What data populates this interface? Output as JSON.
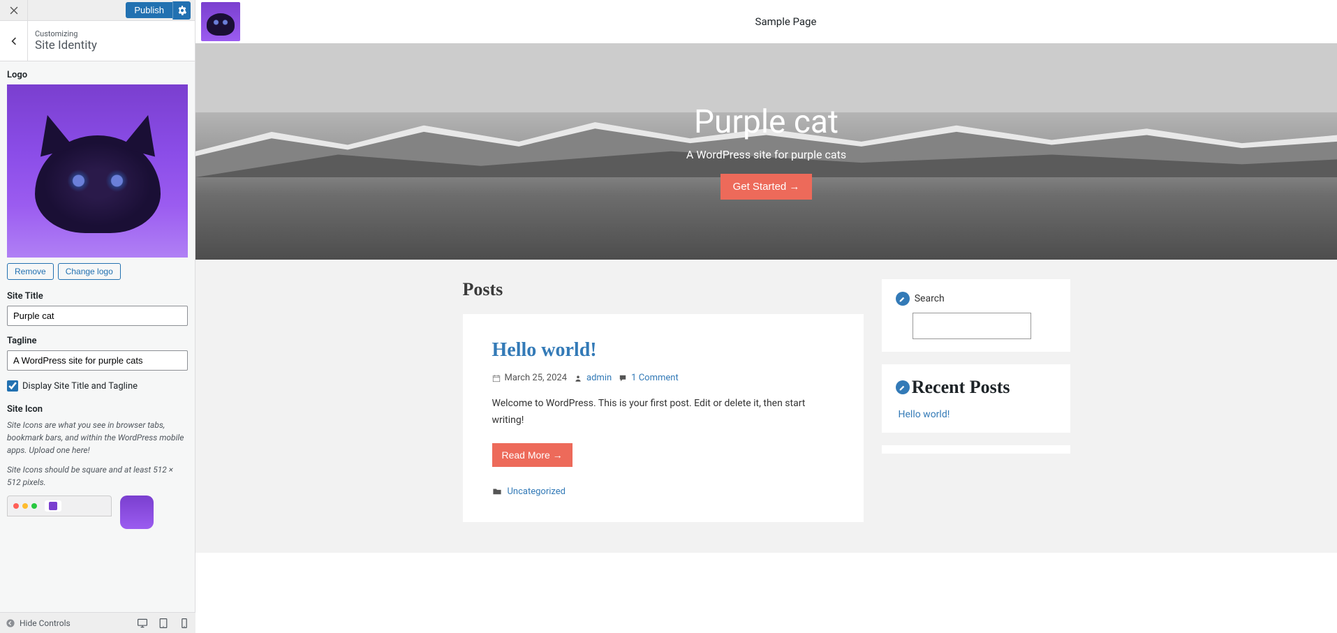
{
  "header": {
    "publish_label": "Publish",
    "customizing_label": "Customizing",
    "section_title": "Site Identity"
  },
  "logo": {
    "label": "Logo",
    "remove_label": "Remove",
    "change_label": "Change logo"
  },
  "site_title": {
    "label": "Site Title",
    "value": "Purple cat"
  },
  "tagline": {
    "label": "Tagline",
    "value": "A WordPress site for purple cats"
  },
  "display_checkbox_label": "Display Site Title and Tagline",
  "site_icon": {
    "label": "Site Icon",
    "desc1": "Site Icons are what you see in browser tabs, bookmark bars, and within the WordPress mobile apps. Upload one here!",
    "desc2": "Site Icons should be square and at least 512 × 512 pixels."
  },
  "bottom_bar": {
    "hide_controls": "Hide Controls"
  },
  "preview": {
    "nav_link": "Sample Page",
    "hero_title": "Purple cat",
    "hero_tagline": "A WordPress site for purple cats",
    "cta_label": "Get Started →",
    "posts_heading": "Posts",
    "post": {
      "title": "Hello world!",
      "date": "March 25, 2024",
      "author": "admin",
      "comments": "1 Comment",
      "excerpt": "Welcome to WordPress. This is your first post. Edit or delete it, then start writing!",
      "read_more": "Read More →",
      "category": "Uncategorized"
    },
    "widgets": {
      "search_label": "Search",
      "recent_posts_heading": "Recent Posts",
      "recent_post_link": "Hello world!"
    }
  }
}
